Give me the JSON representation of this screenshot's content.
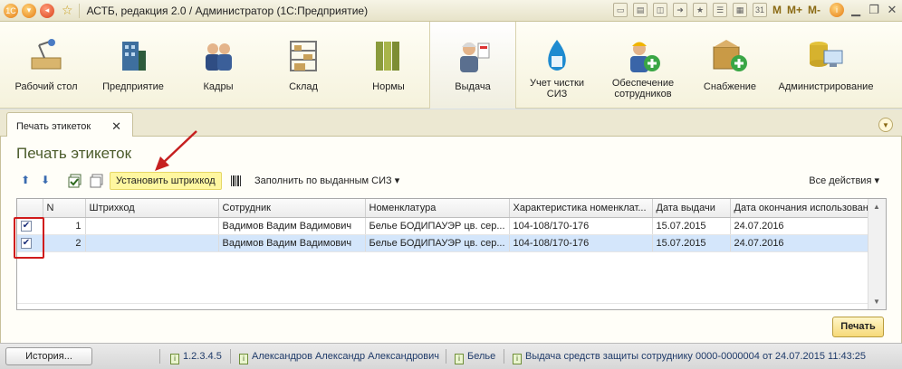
{
  "window": {
    "title": "АСТБ, редакция 2.0 / Администратор  (1С:Предприятие)"
  },
  "toolbar_right": {
    "m": "M",
    "mplus": "M+",
    "mminus": "M-",
    "info": "i",
    "cal": "31"
  },
  "sections": [
    {
      "label": "Рабочий стол",
      "icon": "desk-lamp-icon"
    },
    {
      "label": "Предприятие",
      "icon": "building-icon"
    },
    {
      "label": "Кадры",
      "icon": "people-icon"
    },
    {
      "label": "Склад",
      "icon": "shelves-icon"
    },
    {
      "label": "Нормы",
      "icon": "binders-icon"
    },
    {
      "label": "Выдача",
      "icon": "worker-icon",
      "active": true
    },
    {
      "label": "Учет чистки СИЗ",
      "icon": "cleaning-drop-icon"
    },
    {
      "label": "Обеспечение сотрудников",
      "icon": "worker-add-icon"
    },
    {
      "label": "Снабжение",
      "icon": "box-add-icon"
    },
    {
      "label": "Администрирование",
      "icon": "server-icon"
    }
  ],
  "tab": {
    "label": "Печать этикеток",
    "close": "✕"
  },
  "form": {
    "title": "Печать этикеток",
    "toolbar": {
      "up": "⬆",
      "down": "⬇",
      "set_barcode": "Установить штрихкод",
      "fill_by_issued": "Заполнить по выданным СИЗ ▾",
      "all_actions": "Все действия ▾"
    },
    "columns": [
      "",
      "N",
      "Штрихкод",
      "Сотрудник",
      "Номенклатура",
      "Характеристика номенклат...",
      "Дата выдачи",
      "Дата окончания использован"
    ],
    "rows": [
      {
        "checked": "✔",
        "n": "1",
        "barcode": "",
        "employee": "Вадимов Вадим Вадимович",
        "nomenclature": "Белье БОДИПАУЭР цв. сер...",
        "characteristic": "104-108/170-176",
        "issue_date": "15.07.2015",
        "end_date": "24.07.2016"
      },
      {
        "checked": "✔",
        "n": "2",
        "barcode": "",
        "employee": "Вадимов Вадим Вадимович",
        "nomenclature": "Белье БОДИПАУЭР цв. сер...",
        "characteristic": "104-108/170-176",
        "issue_date": "15.07.2015",
        "end_date": "24.07.2016"
      }
    ],
    "print_button": "Печать"
  },
  "statusbar": {
    "history": "История...",
    "version": "1.2.3.4.5",
    "user": "Александров Александр Александрович",
    "item": "Белье",
    "document": "Выдача средств защиты сотруднику 0000-0000004 от 24.07.2015 11:43:25"
  },
  "colors": {
    "highlight": "#d01b1b",
    "selected_row": "#d4e6fb",
    "barcode_button": "#fff7a0"
  }
}
